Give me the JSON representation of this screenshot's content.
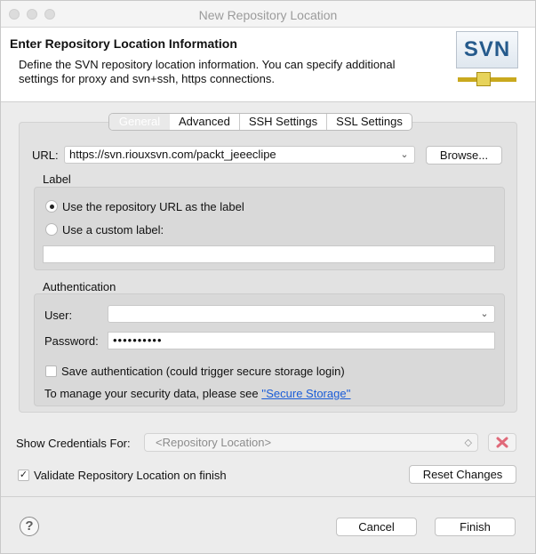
{
  "window": {
    "title": "New Repository Location"
  },
  "header": {
    "title": "Enter Repository Location Information",
    "description": "Define the SVN repository location information. You can specify additional settings for proxy and svn+ssh, https connections.",
    "logo_text": "SVN"
  },
  "tabs": [
    "General",
    "Advanced",
    "SSH Settings",
    "SSL Settings"
  ],
  "general": {
    "url_label": "URL:",
    "url_value": "https://svn.riouxsvn.com/packt_jeeeclipe",
    "browse_button": "Browse...",
    "label_group": {
      "title": "Label",
      "option_repo": "Use the repository URL as the label",
      "option_custom": "Use a custom label:",
      "custom_value": ""
    },
    "auth_group": {
      "title": "Authentication",
      "user_label": "User:",
      "user_value": "",
      "password_label": "Password:",
      "password_value": "••••••••••",
      "save_auth_label": "Save authentication (could trigger secure storage login)",
      "manage_text": "To manage your security data, please see",
      "manage_link": "''Secure Storage''"
    }
  },
  "show_credentials": {
    "label": "Show Credentials For:",
    "placeholder": "<Repository Location>"
  },
  "validate": {
    "label": "Validate Repository Location on finish",
    "checked": true
  },
  "buttons": {
    "reset": "Reset Changes",
    "cancel": "Cancel",
    "finish": "Finish",
    "help": "?"
  },
  "glyphs": {
    "check": "✓",
    "chevron": "⌄",
    "updown": "◇"
  },
  "colors": {
    "link": "#1a5cd8",
    "delete_icon": "#e06a7a"
  }
}
